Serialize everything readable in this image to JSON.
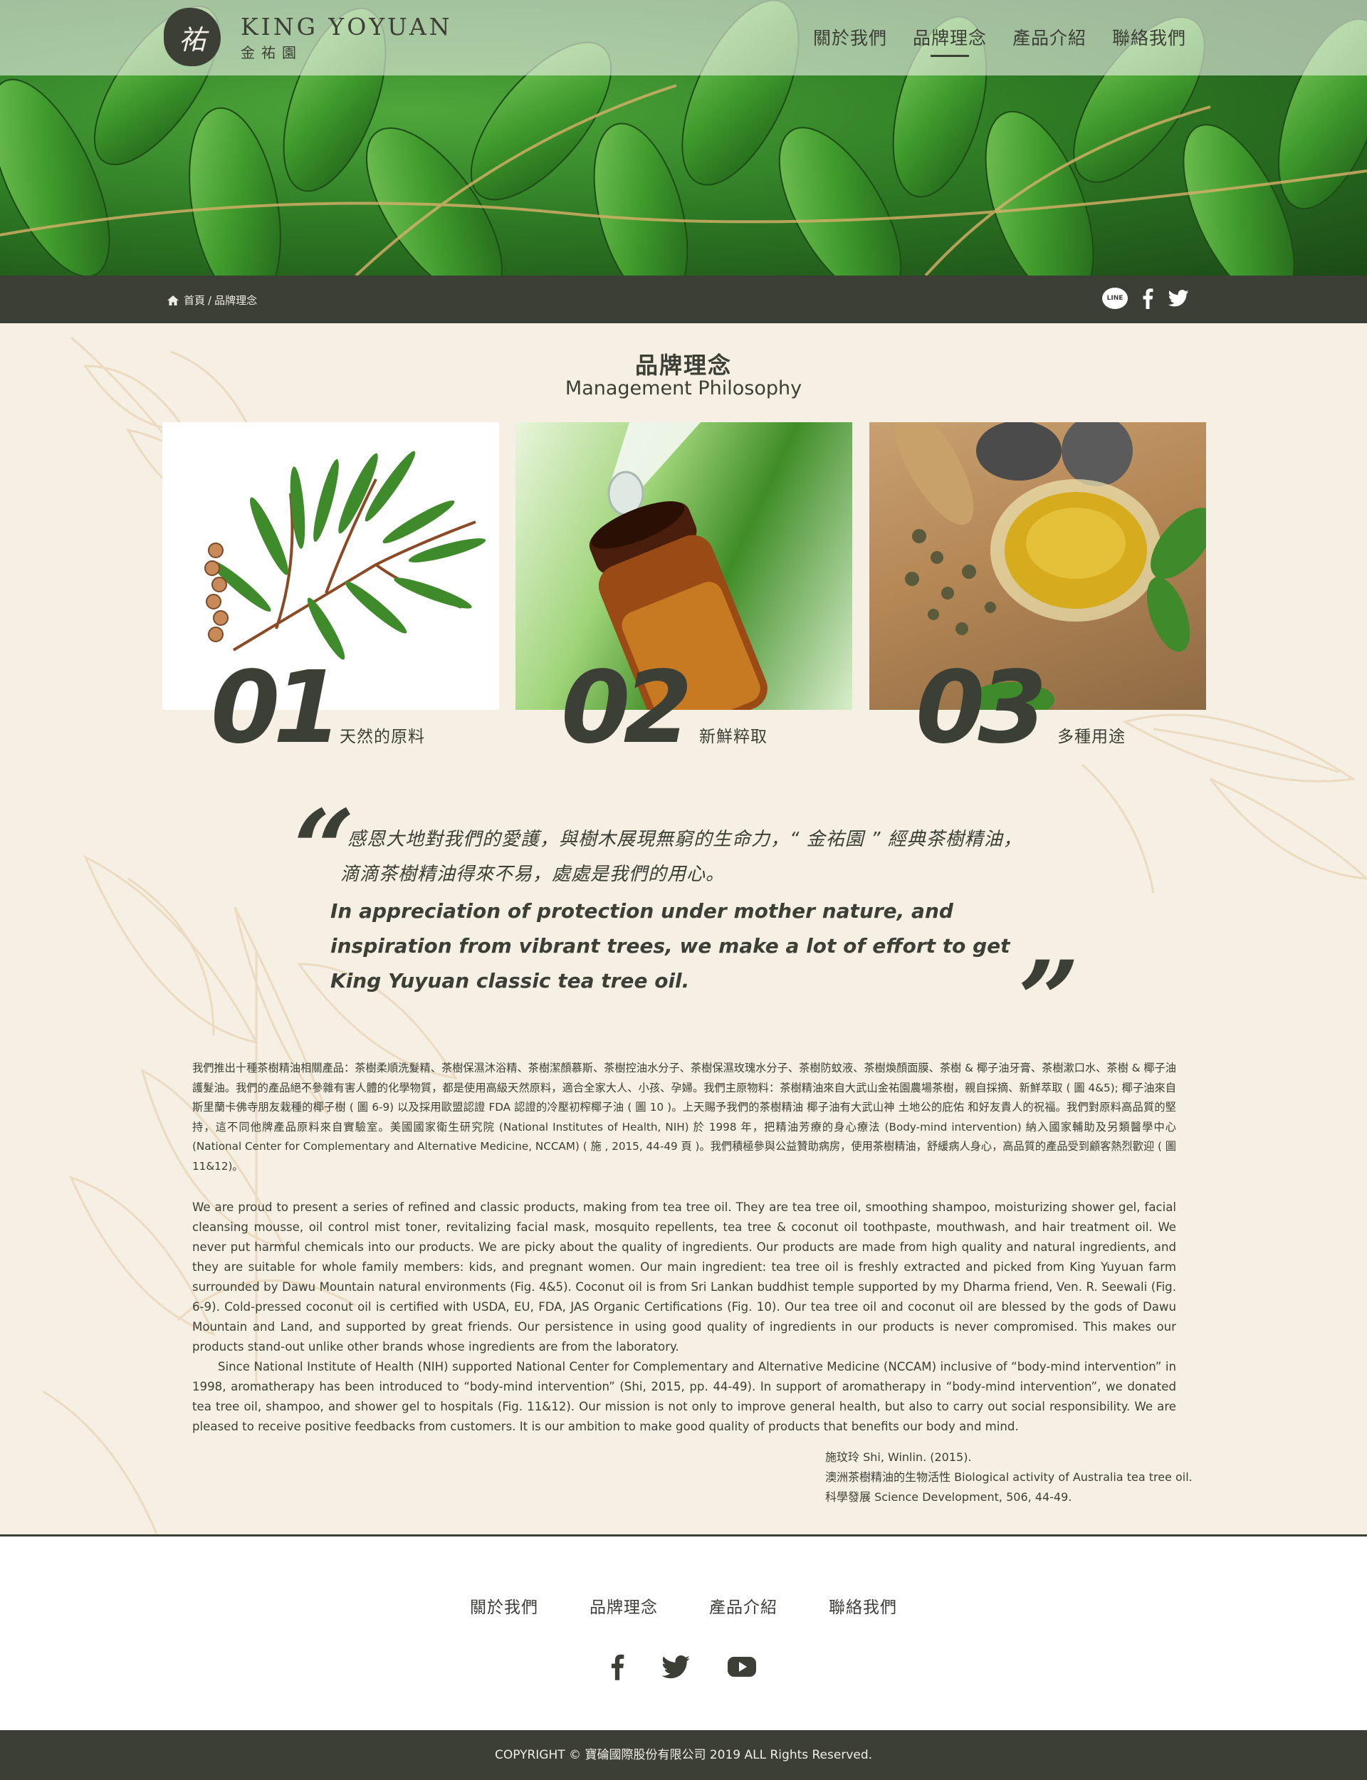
{
  "header": {
    "logo_mark": "祐",
    "logo_en": "KING YOYUAN",
    "logo_zh": "金祐園",
    "nav": [
      {
        "label": "關於我們"
      },
      {
        "label": "品牌理念"
      },
      {
        "label": "產品介紹"
      },
      {
        "label": "聯絡我們"
      }
    ],
    "active_nav": "品牌理念"
  },
  "breadcrumb": {
    "home": "首頁",
    "separator": "/",
    "current": "品牌理念"
  },
  "share": {
    "line_label": "LINE",
    "icons": [
      "line-icon",
      "facebook-icon",
      "twitter-icon"
    ]
  },
  "section": {
    "title_zh": "品牌理念",
    "title_en": "Management Philosophy"
  },
  "features": [
    {
      "number": "01",
      "label": "天然的原料"
    },
    {
      "number": "02",
      "label": "新鮮粹取"
    },
    {
      "number": "03",
      "label": "多種用途"
    }
  ],
  "quote": {
    "open_mark": "“",
    "close_mark": "”",
    "zh_line1": "感恩大地對我們的愛護，與樹木展現無窮的生命力，“ 金祐園 ” 經典茶樹精油，",
    "zh_line2": "滴滴茶樹精油得來不易，處處是我們的用心。",
    "en": "In appreciation of protection under mother nature, and inspiration from vibrant trees, we make a lot of effort to get King Yuyuan classic tea tree oil."
  },
  "body": {
    "zh": "我們推出十種茶樹精油相關產品：茶樹柔順洗髮精、茶樹保濕沐浴精、茶樹潔顏慕斯、茶樹控油水分子、茶樹保濕玫瑰水分子、茶樹防蚊液、茶樹煥顏面膜、茶樹 & 椰子油牙膏、茶樹漱口水、茶樹 & 椰子油護髮油。我們的產品絕不參雜有害人體的化學物質，都是使用高級天然原料，適合全家大人、小孩、孕婦。我們主原物料：茶樹精油來自大武山金祐園農場茶樹，親自採摘、新鮮萃取 ( 圖 4&5); 椰子油來自斯里蘭卡佛寺朋友栽種的椰子樹 ( 圖 6-9) 以及採用歐盟認證 FDA 認證的冷壓初榨椰子油 ( 圖 10 )。上天賜予我們的茶樹精油 椰子油有大武山神 土地公的庇佑 和好友貴人的祝福。我們對原料高品質的堅持，這不同他牌產品原料來自實驗室。美國國家衛生研究院 (National Institutes of Health, NIH) 於 1998 年，把精油芳療的身心療法 (Body-mind intervention) 納入國家輔助及另類醫學中心 (National Center for Complementary and Alternative Medicine, NCCAM) ( 施 , 2015, 44-49 頁 )。我們積極參與公益贊助病房，使用茶樹精油，舒緩病人身心，高品質的產品受到顧客熱烈歡迎 ( 圖 11&12)。",
    "en_p1": "We are proud to present a series of refined and classic products, making from tea tree oil. They are tea tree oil, smoothing shampoo, moisturizing shower gel, facial cleansing mousse, oil control mist toner, revitalizing facial mask, mosquito repellents, tea tree & coconut oil toothpaste, mouthwash, and hair treatment oil. We never put harmful chemicals into our products. We are picky about the quality of ingredients. Our products are made from high quality and natural ingredients, and they are suitable for whole family members: kids, and pregnant women. Our main ingredient: tea tree oil is freshly extracted and picked from King Yuyuan farm surrounded by Dawu Mountain natural environments (Fig. 4&5). Coconut oil is from Sri Lankan buddhist temple supported by my Dharma friend, Ven. R. Seewali (Fig. 6-9). Cold-pressed coconut oil is certified with USDA, EU, FDA, JAS Organic Certifications (Fig. 10). Our tea tree oil and coconut oil are blessed by the gods of Dawu Mountain and Land, and supported by great friends. Our persistence in using good quality of ingredients in our products is never compromised. This makes our products stand-out unlike other brands whose ingredients are from the laboratory.",
    "en_p2": "Since National Institute of Health (NIH) supported National Center for Complementary and Alternative Medicine (NCCAM) inclusive of “body-mind intervention” in 1998, aromatherapy has been introduced to “body-mind intervention” (Shi, 2015, pp. 44-49). In support of aromatherapy in “body-mind intervention”, we donated tea tree oil, shampoo, and shower gel to hospitals (Fig. 11&12). Our mission is not only to improve general health, but also to carry out social responsibility. We are pleased to receive positive feedbacks from customers. It is our ambition to make good quality of products that benefits our body and mind."
  },
  "reference": {
    "line1": "施玟玲 Shi, Winlin. (2015).",
    "line2": "澳洲茶樹精油的生物活性 Biological activity of Australia tea tree oil.",
    "line3": "科學發展 Science Development, 506, 44-49."
  },
  "footer": {
    "nav": [
      {
        "label": "關於我們"
      },
      {
        "label": "品牌理念"
      },
      {
        "label": "產品介紹"
      },
      {
        "label": "聯絡我們"
      }
    ],
    "social_icons": [
      "facebook-icon",
      "twitter-icon",
      "youtube-icon"
    ],
    "copyright": "COPYRIGHT © 寶碖國際股份有限公司 2019 ALL Rights Reserved."
  },
  "colors": {
    "primary_dark": "#3c3f35",
    "page_background": "#f6efe4",
    "leaf_green": "#2f7d25"
  }
}
